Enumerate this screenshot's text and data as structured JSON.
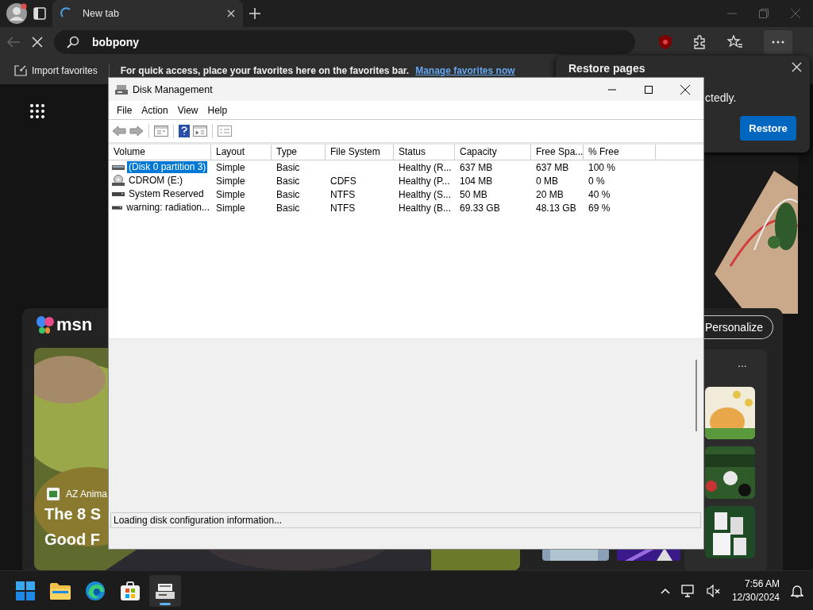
{
  "browser": {
    "tabs": [
      {
        "label": "New tab",
        "selected": true
      }
    ],
    "address": {
      "value": "bobpony"
    },
    "favorites_bar": {
      "import_label": "Import favorites",
      "message": "For quick access, place your favorites here on the favorites bar.",
      "link": "Manage favorites now"
    }
  },
  "restore_popup": {
    "title": "Restore pages",
    "message": "ctedly.",
    "button": "Restore"
  },
  "msn": {
    "logo": "msn",
    "personalize": "Personalize",
    "more": "...",
    "story": {
      "source": "AZ Anima",
      "headline": [
        "The 8 S",
        "Good F"
      ]
    }
  },
  "disk_management": {
    "title": "Disk Management",
    "menu": [
      "File",
      "Action",
      "View",
      "Help"
    ],
    "columns": [
      "Volume",
      "Layout",
      "Type",
      "File System",
      "Status",
      "Capacity",
      "Free Spa...",
      "% Free"
    ],
    "rows": [
      {
        "kind": "disk",
        "selected": true,
        "cells": [
          "(Disk 0 partition 3)",
          "Simple",
          "Basic",
          "",
          "Healthy (R...",
          "637 MB",
          "637 MB",
          "100 %"
        ]
      },
      {
        "kind": "cdrom",
        "selected": false,
        "cells": [
          "CDROM (E:)",
          "Simple",
          "Basic",
          "CDFS",
          "Healthy (P...",
          "104 MB",
          "0 MB",
          "0 %"
        ]
      },
      {
        "kind": "drive",
        "selected": false,
        "cells": [
          "System Reserved",
          "Simple",
          "Basic",
          "NTFS",
          "Healthy (S...",
          "50 MB",
          "20 MB",
          "40 %"
        ]
      },
      {
        "kind": "drive",
        "selected": false,
        "cells": [
          "warning: radiation...",
          "Simple",
          "Basic",
          "NTFS",
          "Healthy (B...",
          "69.33 GB",
          "48.13 GB",
          "69 %"
        ]
      }
    ],
    "status": "Loading disk configuration information..."
  },
  "taskbar": {
    "apps": [
      {
        "kind": "start",
        "selected": false
      },
      {
        "kind": "folder",
        "selected": false
      },
      {
        "kind": "edge",
        "selected": false
      },
      {
        "kind": "store",
        "selected": false
      },
      {
        "kind": "disk",
        "selected": true
      }
    ],
    "time": "7:56 AM",
    "date": "12/30/2024"
  }
}
